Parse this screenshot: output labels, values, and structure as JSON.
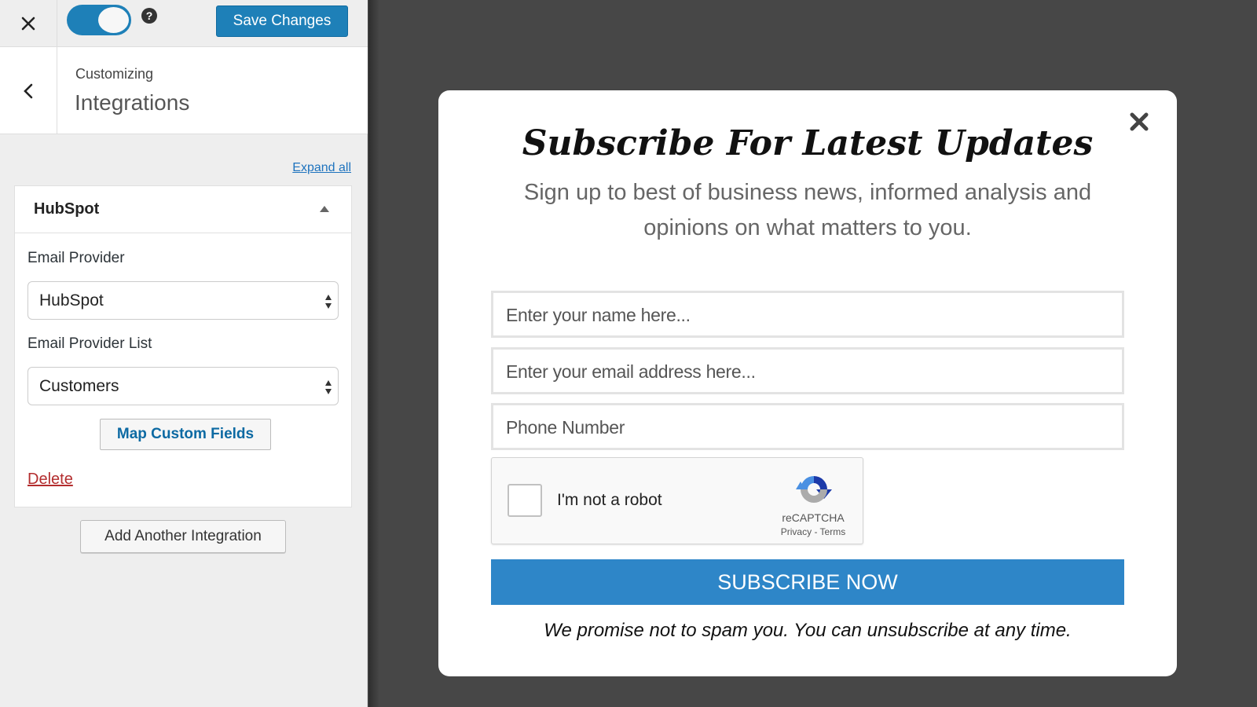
{
  "topbar": {
    "close_label": "Close",
    "toggle_on": true,
    "help_glyph": "?",
    "save_label": "Save Changes"
  },
  "header": {
    "small": "Customizing",
    "title": "Integrations"
  },
  "panel": {
    "expand_all": "Expand all",
    "integration": {
      "title": "HubSpot",
      "expanded": true,
      "fields": [
        {
          "label": "Email Provider",
          "value": "HubSpot"
        },
        {
          "label": "Email Provider List",
          "value": "Customers"
        }
      ],
      "map_button": "Map Custom Fields",
      "delete_link": "Delete"
    },
    "add_button": "Add Another Integration"
  },
  "modal": {
    "title": "Subscribe For Latest Updates",
    "subtitle": "Sign up to best of business news, informed analysis and opinions on what matters to you.",
    "inputs": [
      {
        "placeholder": "Enter your name here..."
      },
      {
        "placeholder": "Enter your email address here..."
      },
      {
        "placeholder": "Phone Number"
      }
    ],
    "captcha": {
      "label": "I'm not a robot",
      "brand": "reCAPTCHA",
      "links": "Privacy - Terms",
      "checked": false
    },
    "subscribe_button": "SUBSCRIBE NOW",
    "disclaimer": "We promise not to spam you. You can unsubscribe at any time."
  },
  "colors": {
    "accent": "#1e80b8",
    "subscribe": "#2e86c8",
    "delete": "#b32d2e",
    "preview_bg": "#474747"
  }
}
